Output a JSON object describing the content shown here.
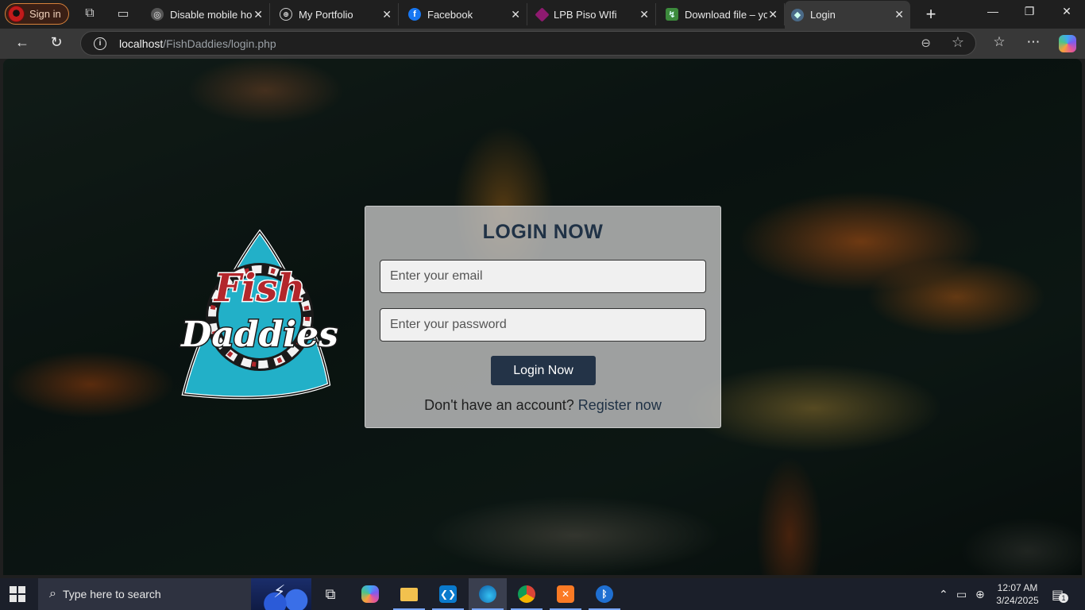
{
  "browser": {
    "profile_label": "Sign in",
    "tabs": [
      {
        "title": "Disable mobile hor",
        "favicon": "globe-gray-icon"
      },
      {
        "title": "My Portfolio",
        "favicon": "globe-icon"
      },
      {
        "title": "Facebook",
        "favicon": "facebook-icon"
      },
      {
        "title": "LPB Piso WIfi",
        "favicon": "lpb-icon"
      },
      {
        "title": "Download file – yo",
        "favicon": "download-icon"
      },
      {
        "title": "Login",
        "favicon": "fish-icon",
        "active": true
      }
    ],
    "url_host": "localhost",
    "url_path": "/FishDaddies/login.php"
  },
  "page": {
    "logo_line1": "Fish",
    "logo_line2": "Daddies",
    "login_title": "LOGIN NOW",
    "email_placeholder": "Enter your email",
    "password_placeholder": "Enter your password",
    "login_button": "Login Now",
    "register_prompt": "Don't have an account?",
    "register_link": "Register now",
    "colors": {
      "card_title": "#203246",
      "button_bg": "#233347",
      "logo_teal": "#22b0c8",
      "logo_red": "#b3262b"
    }
  },
  "taskbar": {
    "search_placeholder": "Type here to search",
    "time": "12:07 AM",
    "date": "3/24/2025",
    "notification_count": "1",
    "apps": [
      "task-view-icon",
      "copilot-icon",
      "file-explorer-icon",
      "vscode-icon",
      "edge-icon",
      "chrome-icon",
      "xampp-icon",
      "bluetooth-icon"
    ]
  }
}
